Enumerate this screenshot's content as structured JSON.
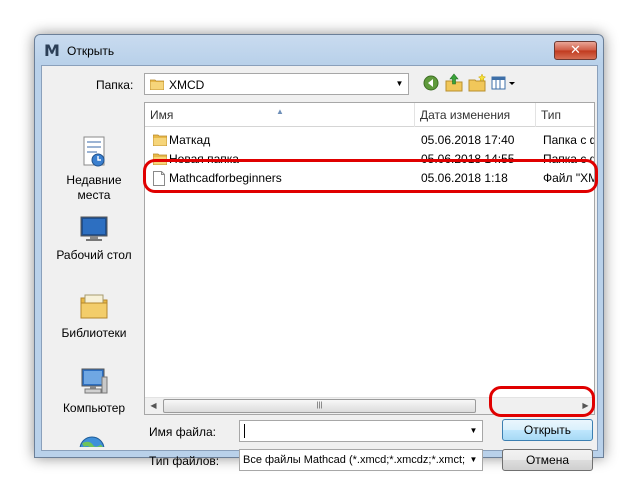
{
  "window": {
    "title": "Открыть",
    "app_icon_text": "M",
    "close_symbol": "✕"
  },
  "folder_bar": {
    "label": "Папка:",
    "current_folder": "XMCD"
  },
  "toolbar": {
    "icons": [
      "back-icon",
      "up-folder-icon",
      "new-folder-icon",
      "view-menu-icon"
    ]
  },
  "places": [
    {
      "label": "Недавние места",
      "icon": "recent-places-icon"
    },
    {
      "label": "Рабочий стол",
      "icon": "desktop-icon"
    },
    {
      "label": "Библиотеки",
      "icon": "libraries-icon"
    },
    {
      "label": "Компьютер",
      "icon": "computer-icon"
    },
    {
      "label": "",
      "icon": "network-icon"
    }
  ],
  "file_list": {
    "columns": [
      "Имя",
      "Дата изменения",
      "Тип"
    ],
    "sort_indicator": "▲",
    "rows": [
      {
        "name": "Маткад",
        "date": "05.06.2018 17:40",
        "type": "Папка с ф",
        "icon": "folder-icon"
      },
      {
        "name": "Новая папка",
        "date": "05.06.2018 14:55",
        "type": "Папка с ф",
        "icon": "folder-icon"
      },
      {
        "name": "Mathcadforbeginners",
        "date": "05.06.2018 1:18",
        "type": "Файл \"XM",
        "icon": "file-icon"
      }
    ],
    "scroll_grip": "|||"
  },
  "form": {
    "filename_label": "Имя файла:",
    "filename_value": "",
    "filetype_label": "Тип файлов:",
    "filetype_value": "Все файлы Mathcad (*.xmcd;*.xmcdz;*.xmct;*.i"
  },
  "buttons": {
    "open": "Открыть",
    "cancel": "Отмена"
  },
  "colors": {
    "highlight": "#e00000",
    "titlebar": "#b9d1ea",
    "close_button": "#c0391e"
  }
}
